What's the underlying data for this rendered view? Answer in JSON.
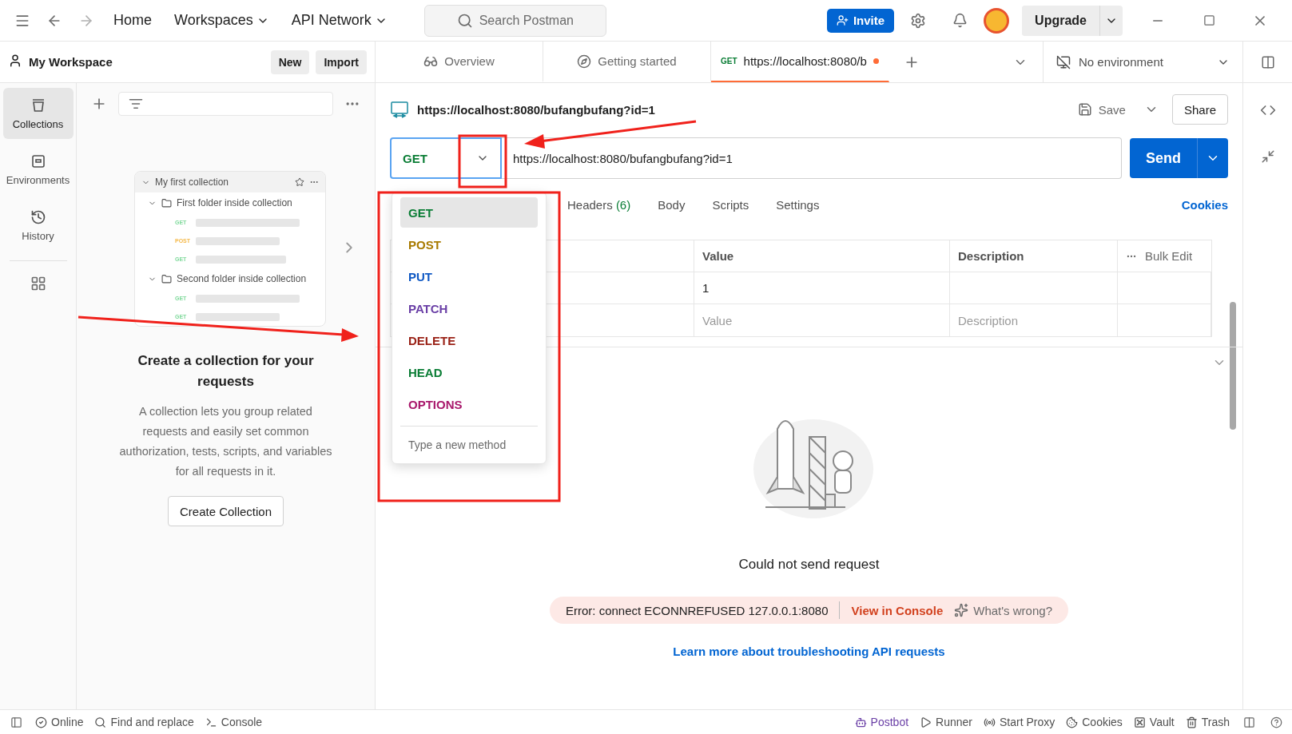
{
  "titlebar": {
    "nav": [
      {
        "label": "Home",
        "caret": false
      },
      {
        "label": "Workspaces",
        "caret": true
      },
      {
        "label": "API Network",
        "caret": true
      }
    ],
    "search": {
      "placeholder": "Search Postman"
    },
    "invite": "Invite",
    "upgrade": "Upgrade"
  },
  "workspace": {
    "title": "My Workspace",
    "buttons": [
      "New",
      "Import"
    ]
  },
  "rail": [
    {
      "label": "Collections",
      "kind": "collections",
      "selected": true
    },
    {
      "label": "Environments",
      "kind": "environments",
      "selected": false
    },
    {
      "label": "History",
      "kind": "history",
      "selected": false
    }
  ],
  "collection_preview": {
    "title": "My first collection",
    "folders": [
      {
        "name": "First folder inside collection",
        "children": [
          {
            "method": "GET",
            "color": "#7ed99a"
          },
          {
            "method": "POST",
            "color": "#f5b94a"
          },
          {
            "method": "GET",
            "color": "#7ed99a"
          }
        ]
      },
      {
        "name": "Second folder inside collection",
        "children": [
          {
            "method": "GET",
            "color": "#7ed99a"
          },
          {
            "method": "GET",
            "color": "#7ed99a"
          }
        ]
      }
    ]
  },
  "empty_state": {
    "heading": "Create a collection for your requests",
    "body": "A collection lets you group related requests and easily set common authorization, tests, scripts, and variables for all requests in it.",
    "button": "Create Collection"
  },
  "tabs": [
    {
      "kind": "overview",
      "label": "Overview",
      "selected": false,
      "unsaved": false
    },
    {
      "kind": "guide",
      "label": "Getting started",
      "selected": false,
      "unsaved": false
    },
    {
      "kind": "request",
      "method": "GET",
      "label": "https://localhost:8080/b",
      "selected": true,
      "unsaved": true
    }
  ],
  "environment": "No environment",
  "request": {
    "title": "https://localhost:8080/bufangbufang?id=1",
    "save": "Save",
    "share": "Share",
    "method": "GET",
    "url": "https://localhost:8080/bufangbufang?id=1",
    "send": "Send"
  },
  "method_menu": {
    "items": [
      {
        "label": "GET",
        "color": "#0a7d35",
        "selected": true
      },
      {
        "label": "POST",
        "color": "#a87a00",
        "selected": false
      },
      {
        "label": "PUT",
        "color": "#1059c4",
        "selected": false
      },
      {
        "label": "PATCH",
        "color": "#6a3fa6",
        "selected": false
      },
      {
        "label": "DELETE",
        "color": "#9a2217",
        "selected": false
      },
      {
        "label": "HEAD",
        "color": "#0a7d35",
        "selected": false
      },
      {
        "label": "OPTIONS",
        "color": "#a8176b",
        "selected": false
      }
    ],
    "placeholder": "Type a new method"
  },
  "request_tabs": [
    {
      "label": "Headers",
      "count": "(6)"
    },
    {
      "label": "Body"
    },
    {
      "label": "Scripts"
    },
    {
      "label": "Settings"
    }
  ],
  "cookies": "Cookies",
  "params_table": {
    "columns": [
      "Value",
      "Description"
    ],
    "bulk_edit": "Bulk Edit",
    "rows": [
      {
        "value": "1"
      }
    ],
    "placeholders": {
      "value": "Value",
      "description": "Description"
    }
  },
  "response": {
    "message": "Could not send request",
    "error": "Error: connect ECONNREFUSED 127.0.0.1:8080",
    "console_link": "View in Console",
    "help": "What's wrong?",
    "learn_more": "Learn more about troubleshooting API requests"
  },
  "status_bar": {
    "left": [
      {
        "kind": "online",
        "label": "Online"
      },
      {
        "kind": "find",
        "label": "Find and replace"
      },
      {
        "kind": "console",
        "label": "Console"
      }
    ],
    "right": [
      {
        "kind": "postbot",
        "label": "Postbot"
      },
      {
        "kind": "runner",
        "label": "Runner"
      },
      {
        "kind": "proxy",
        "label": "Start Proxy"
      },
      {
        "kind": "cookies",
        "label": "Cookies"
      },
      {
        "kind": "vault",
        "label": "Vault"
      },
      {
        "kind": "trash",
        "label": "Trash"
      }
    ]
  }
}
